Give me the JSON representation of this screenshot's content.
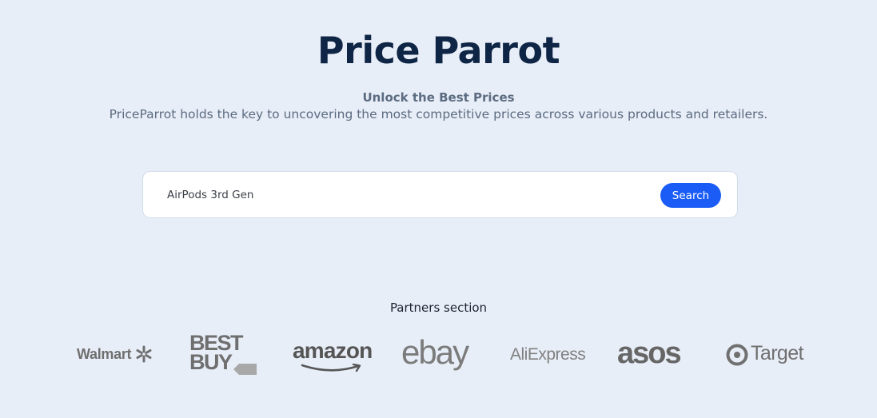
{
  "header": {
    "title": "Price Parrot",
    "subtitle": "Unlock the Best Prices",
    "description": "PriceParrot holds the key to uncovering the most competitive prices across various products and retailers."
  },
  "search": {
    "value": "AirPods 3rd Gen",
    "button_label": "Search",
    "button_color": "#1a5cf5"
  },
  "partners": {
    "title": "Partners section",
    "logos": [
      {
        "name": "Walmart",
        "text": "Walmart",
        "icon": "walmart-spark-icon"
      },
      {
        "name": "Best Buy",
        "line1": "BEST",
        "line2": "BUY",
        "icon": "bestbuy-tag-icon"
      },
      {
        "name": "Amazon",
        "text": "amazon",
        "icon": "amazon-smile-icon"
      },
      {
        "name": "eBay",
        "text": "ebay"
      },
      {
        "name": "AliExpress",
        "text": "AliExpress"
      },
      {
        "name": "ASOS",
        "text": "asos"
      },
      {
        "name": "Target",
        "text": "Target",
        "icon": "target-bullseye-icon"
      }
    ]
  },
  "colors": {
    "background": "#e8eef8",
    "title": "#0f2545",
    "muted_text": "#5b6b80",
    "logo_gray": "#6f6f6f"
  }
}
